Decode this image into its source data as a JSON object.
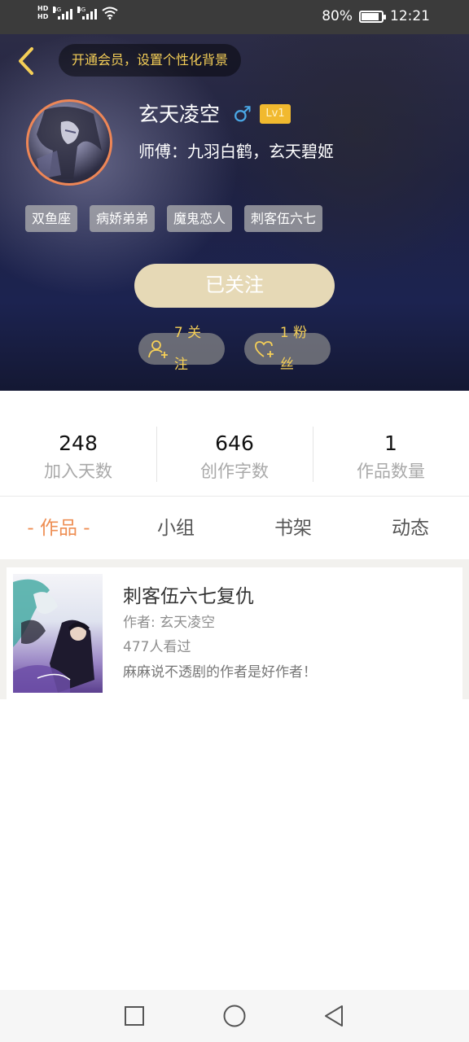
{
  "status_bar": {
    "hd1": "HD",
    "hd2": "HD",
    "net1": "4G",
    "net2": "4G",
    "battery_text": "80%",
    "battery_level": 0.8,
    "time": "12:21"
  },
  "header": {
    "vip_banner": "开通会员，设置个性化背景",
    "username": "玄天凌空",
    "gender_symbol": "♂",
    "level": "Lv1",
    "master": "师傅：九羽白鹤，玄天碧姬",
    "tags": [
      "双鱼座",
      "病娇弟弟",
      "魔鬼恋人",
      "刺客伍六七"
    ],
    "follow_button": "已关注",
    "following_label": "7 关注",
    "fans_label": "1 粉丝"
  },
  "stats": [
    {
      "value": "248",
      "label": "加入天数"
    },
    {
      "value": "646",
      "label": "创作字数"
    },
    {
      "value": "1",
      "label": "作品数量"
    }
  ],
  "tabs": [
    "- 作品 -",
    "小组",
    "书架",
    "动态"
  ],
  "works": [
    {
      "title": "刺客伍六七复仇",
      "author": "作者: 玄天凌空",
      "views": "477人看过",
      "description": "麻麻说不透剧的作者是好作者！"
    }
  ],
  "colors": {
    "accent": "#ee8e53",
    "gold": "#f5cf57",
    "level_badge": "#f1b92f",
    "follow_button": "#e6d9b6",
    "gender": "#4aa8e6"
  }
}
